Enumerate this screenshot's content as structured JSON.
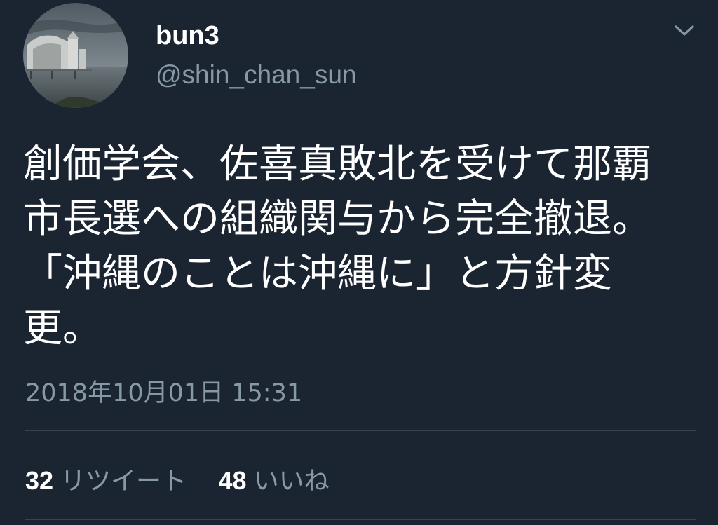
{
  "user": {
    "display_name": "bun3",
    "handle": "@shin_chan_sun"
  },
  "tweet": {
    "text": "創価学会、佐喜真敗北を受けて那覇市長選への組織関与から完全撤退。「沖縄のことは沖縄に」と方針変更。",
    "timestamp": "2018年10月01日 15:31"
  },
  "stats": {
    "retweets_count": "32",
    "retweets_label": "リツイート",
    "likes_count": "48",
    "likes_label": "いいね"
  },
  "icons": {
    "menu": "chevron-down-icon"
  },
  "colors": {
    "background": "#1b2431",
    "secondary_text": "#8899a6",
    "divider": "#38444d"
  }
}
